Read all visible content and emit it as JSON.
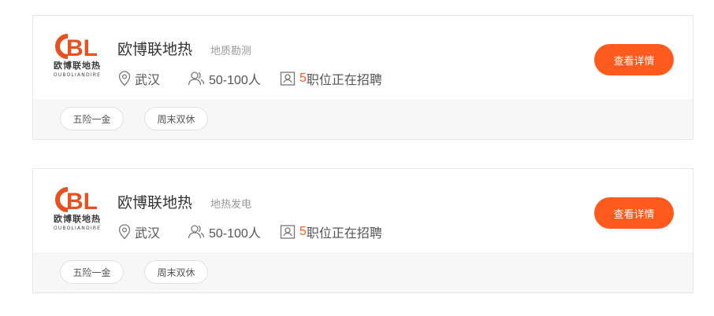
{
  "companies": [
    {
      "logo": {
        "cn": "欧博联地热",
        "en": "OUBOLIANDIRE",
        "brand_letters": "BL"
      },
      "name": "欧博联地热",
      "industry": "地质勘测",
      "city": "武汉",
      "size": "50-100人",
      "job_count": "5",
      "job_text": "职位正在招聘",
      "button_label": "查看详情",
      "tags": [
        "五险一金",
        "周末双休"
      ]
    },
    {
      "logo": {
        "cn": "欧博联地热",
        "en": "OUBOLIANDIRE",
        "brand_letters": "BL"
      },
      "name": "欧博联地热",
      "industry": "地热发电",
      "city": "武汉",
      "size": "50-100人",
      "job_count": "5",
      "job_text": "职位正在招聘",
      "button_label": "查看详情",
      "tags": [
        "五险一金",
        "周末双休"
      ]
    }
  ],
  "icons": {
    "location": "location-pin-icon",
    "size": "people-icon",
    "jobs": "briefcase-icon"
  },
  "colors": {
    "accent": "#ff5b1f",
    "job_count": "#ff5a1f",
    "logo_orange": "#e8501f"
  }
}
